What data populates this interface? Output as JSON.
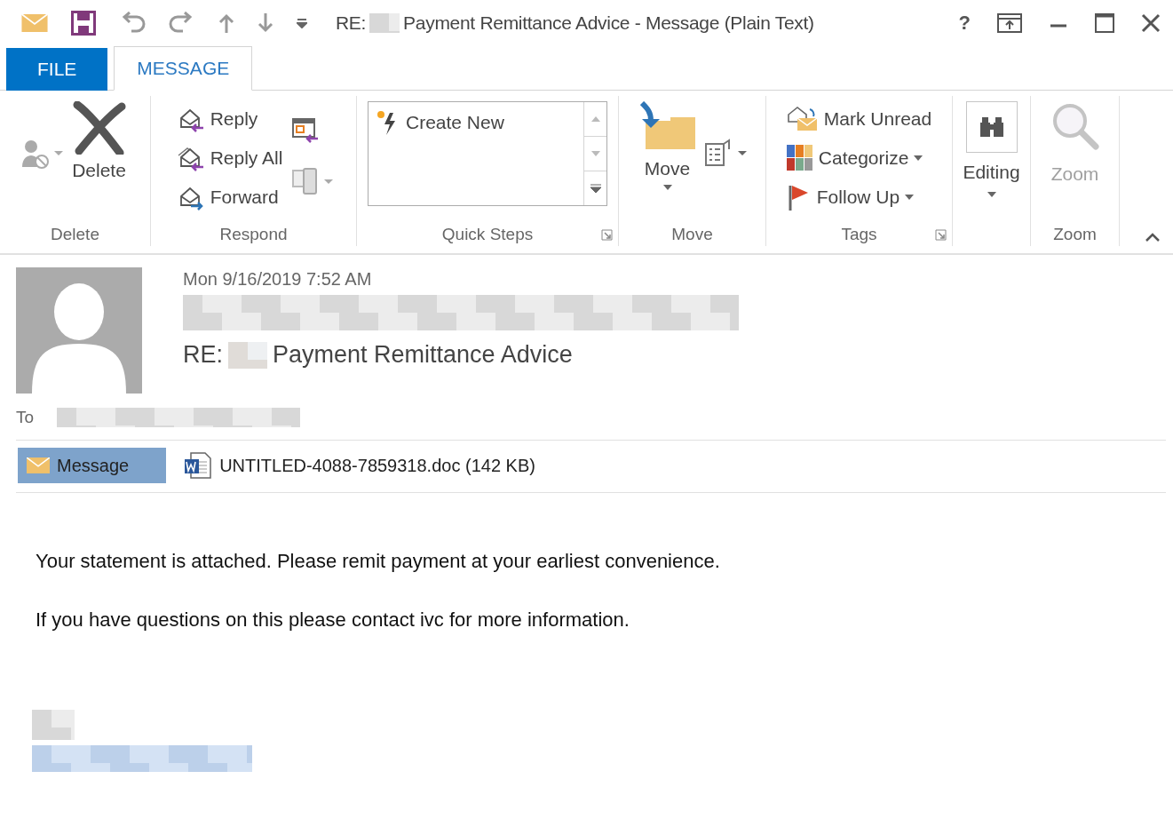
{
  "window": {
    "title_prefix": "RE:",
    "title_rest": "Payment Remittance Advice - Message (Plain Text)",
    "help": "?"
  },
  "ribbon_tabs": [
    {
      "label": "FILE",
      "kind": "file",
      "selected": false
    },
    {
      "label": "MESSAGE",
      "kind": "tab",
      "selected": true
    }
  ],
  "groups": [
    {
      "kind": "delete",
      "label": "Delete",
      "launcher": false,
      "buttons": [
        {
          "label": "Delete",
          "dropdown": false,
          "disabled": false
        }
      ]
    },
    {
      "kind": "respond",
      "label": "Respond",
      "launcher": false,
      "buttons": [
        {
          "label": "Reply",
          "dropdown": false,
          "disabled": false
        },
        {
          "label": "Reply All",
          "dropdown": false,
          "disabled": false
        },
        {
          "label": "Forward",
          "dropdown": false,
          "disabled": false
        }
      ]
    },
    {
      "kind": "quicksteps",
      "label": "Quick Steps",
      "launcher": true,
      "buttons": [
        {
          "label": "Create New",
          "dropdown": false,
          "disabled": false
        }
      ]
    },
    {
      "kind": "move",
      "label": "Move",
      "launcher": false,
      "buttons": [
        {
          "label": "Move",
          "dropdown": true,
          "disabled": false
        }
      ]
    },
    {
      "kind": "tags",
      "label": "Tags",
      "launcher": true,
      "buttons": [
        {
          "label": "Mark Unread",
          "dropdown": false,
          "disabled": false
        },
        {
          "label": "Categorize",
          "dropdown": true,
          "disabled": false
        },
        {
          "label": "Follow Up",
          "dropdown": true,
          "disabled": false
        }
      ]
    },
    {
      "kind": "editing",
      "launcher": false,
      "buttons": [
        {
          "label": "Editing",
          "dropdown": true,
          "disabled": false
        }
      ]
    },
    {
      "kind": "zoom",
      "label": "Zoom",
      "launcher": false,
      "buttons": [
        {
          "label": "Zoom",
          "dropdown": false,
          "disabled": true
        }
      ]
    }
  ],
  "header": {
    "date": "Mon 9/16/2019 7:52 AM",
    "subject_prefix": "RE:",
    "subject": "Payment Remittance Advice",
    "to_label": "To"
  },
  "attachments": [
    {
      "label": "Message",
      "kind": "message",
      "selected": true
    },
    {
      "label": "UNTITLED-4088-7859318.doc (142 KB)",
      "kind": "doc",
      "selected": false
    }
  ],
  "body": [
    "Your statement is attached. Please remit payment at your earliest convenience.",
    "If you have questions on this please contact ivc for more information."
  ]
}
